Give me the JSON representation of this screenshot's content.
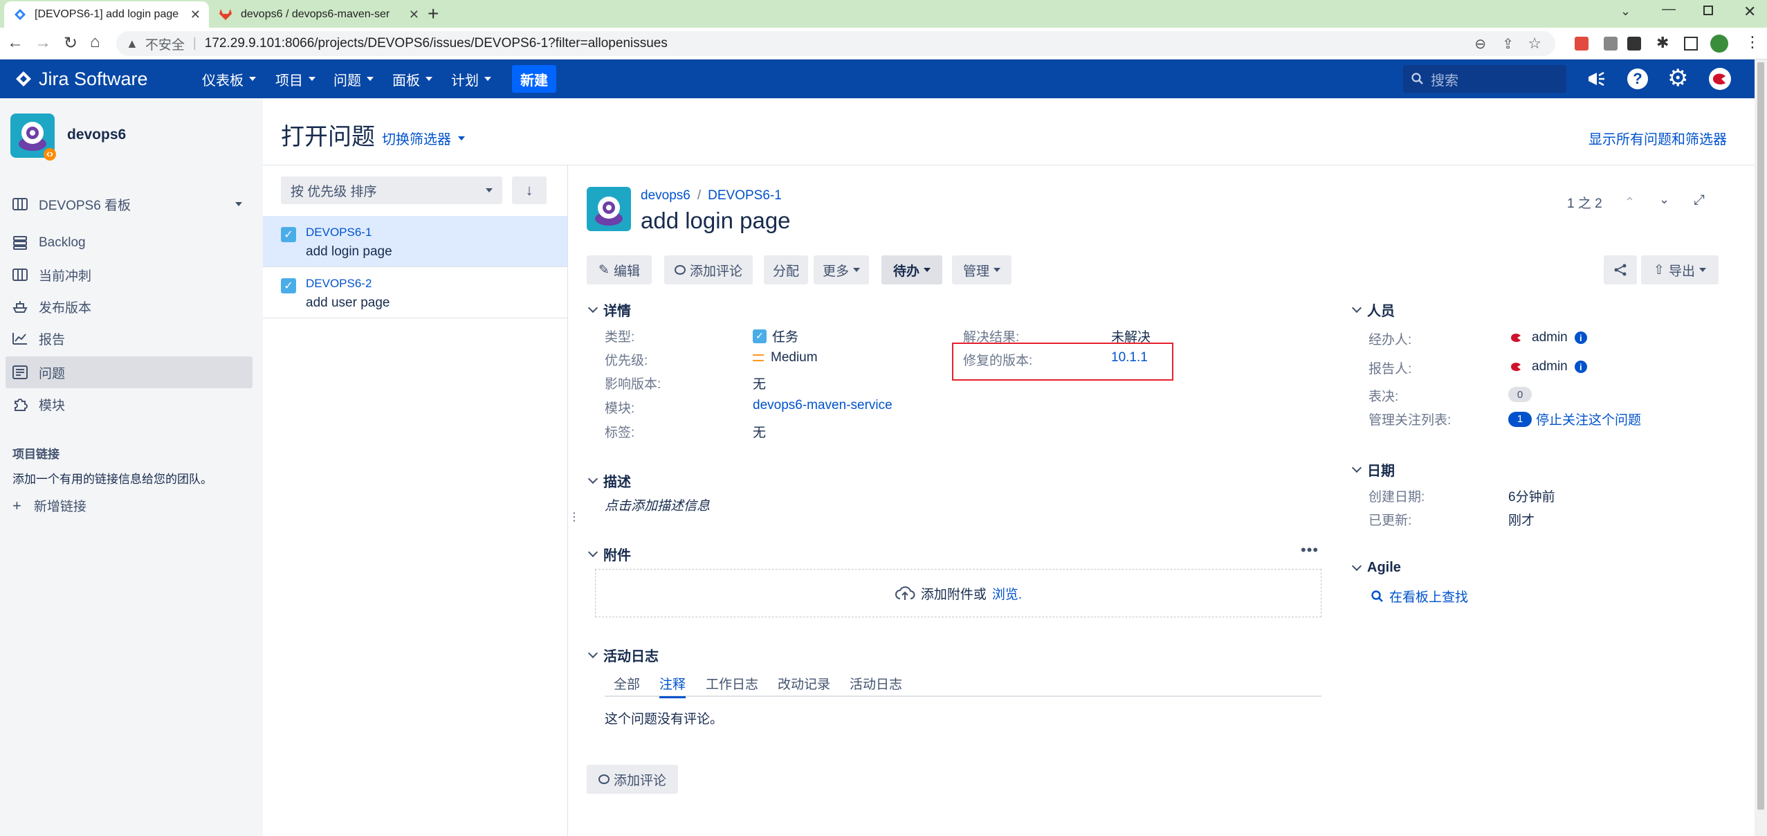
{
  "browser": {
    "tabs": [
      {
        "title": "[DEVOPS6-1] add login page -"
      },
      {
        "title": "devops6 / devops6-maven-ser"
      }
    ],
    "security_label": "不安全",
    "url": "172.29.9.101:8066/projects/DEVOPS6/issues/DEVOPS6-1?filter=allopenissues"
  },
  "nav": {
    "logo": "Jira Software",
    "items": [
      "仪表板",
      "项目",
      "问题",
      "面板",
      "计划"
    ],
    "create": "新建",
    "search_placeholder": "搜索"
  },
  "sidebar": {
    "project_name": "devops6",
    "board": "DEVOPS6 看板",
    "items": [
      "Backlog",
      "当前冲刺",
      "发布版本",
      "报告",
      "问题",
      "模块"
    ],
    "links_title": "项目链接",
    "links_desc": "添加一个有用的链接信息给您的团队。",
    "add_link": "新增链接"
  },
  "header": {
    "title": "打开问题",
    "switch_filter": "切换筛选器",
    "show_all": "显示所有问题和筛选器"
  },
  "list": {
    "sort_label": "按 优先级 排序",
    "issues": [
      {
        "key": "DEVOPS6-1",
        "summary": "add login page"
      },
      {
        "key": "DEVOPS6-2",
        "summary": "add user page"
      }
    ]
  },
  "issue": {
    "breadcrumb_project": "devops6",
    "breadcrumb_sep": "/",
    "key": "DEVOPS6-1",
    "summary": "add login page",
    "pager": "1 之 2",
    "actions": {
      "edit": "编辑",
      "comment": "添加评论",
      "assign": "分配",
      "more": "更多",
      "status": "待办",
      "admin": "管理",
      "export": "导出"
    },
    "details_title": "详情",
    "details": {
      "type_label": "类型:",
      "type_value": "任务",
      "priority_label": "优先级:",
      "priority_value": "Medium",
      "affects_label": "影响版本:",
      "affects_value": "无",
      "component_label": "模块:",
      "component_value": "devops6-maven-service",
      "labels_label": "标签:",
      "labels_value": "无",
      "resolution_label": "解决结果:",
      "resolution_value": "未解决",
      "fix_label": "修复的版本:",
      "fix_value": "10.1.1"
    },
    "description_title": "描述",
    "description_placeholder": "点击添加描述信息",
    "attachments_title": "附件",
    "attach_text": "添加附件或",
    "attach_browse": "浏览.",
    "activity_title": "活动日志",
    "activity_tabs": [
      "全部",
      "注释",
      "工作日志",
      "改动记录",
      "活动日志"
    ],
    "no_comments": "这个问题没有评论。",
    "add_comment": "添加评论"
  },
  "people": {
    "title": "人员",
    "assignee_label": "经办人:",
    "assignee": "admin",
    "reporter_label": "报告人:",
    "reporter": "admin",
    "votes_label": "表决:",
    "votes": "0",
    "watchers_label": "管理关注列表:",
    "watchers": "1",
    "stop_watching": "停止关注这个问题"
  },
  "dates": {
    "title": "日期",
    "created_label": "创建日期:",
    "created": "6分钟前",
    "updated_label": "已更新:",
    "updated": "刚才"
  },
  "agile": {
    "title": "Agile",
    "view_board": "在看板上查找"
  },
  "colors": {
    "nav_bg": "#0747a6",
    "link": "#0052cc",
    "highlight_box": "#e5202c",
    "chrome_tab_bar": "#cde8c7"
  }
}
